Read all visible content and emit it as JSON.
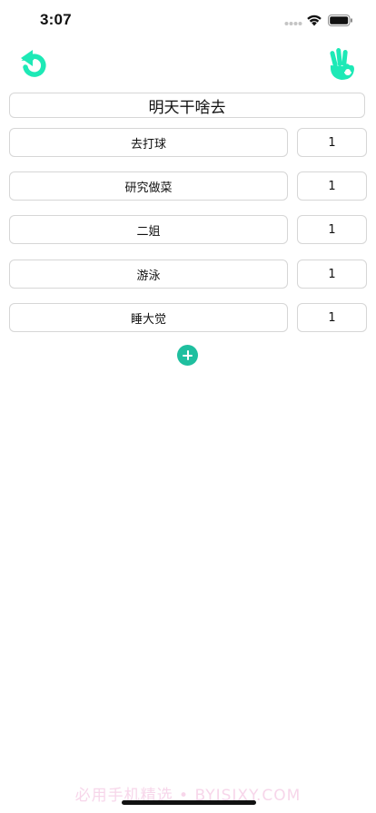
{
  "status_bar": {
    "time": "3:07"
  },
  "colors": {
    "accent": "#1de9b6",
    "add_button": "#1fbf9f",
    "border": "#d6d6d6"
  },
  "toolbar": {
    "back_icon": "undo-arrow-icon",
    "confirm_icon": "ok-hand-icon"
  },
  "title": "明天干啥去",
  "options": [
    {
      "name": "去打球",
      "weight": "1"
    },
    {
      "name": "研究做菜",
      "weight": "1"
    },
    {
      "name": "二姐",
      "weight": "1"
    },
    {
      "name": "游泳",
      "weight": "1"
    },
    {
      "name": "睡大觉",
      "weight": "1"
    }
  ],
  "add_icon": "plus-circle-icon",
  "watermark": "必用手机精选 • BYJSJXY.COM"
}
